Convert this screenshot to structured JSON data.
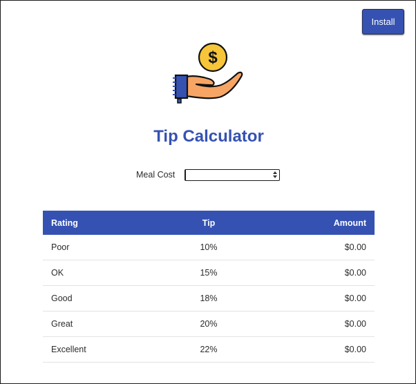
{
  "header": {
    "install_label": "Install"
  },
  "logo": {
    "icon": "hand-holding-dollar-coin-icon",
    "coin_symbol": "$"
  },
  "page": {
    "title": "Tip Calculator"
  },
  "form": {
    "meal_cost_label": "Meal Cost",
    "meal_cost_value": ""
  },
  "table": {
    "headers": {
      "rating": "Rating",
      "tip": "Tip",
      "amount": "Amount"
    },
    "rows": [
      {
        "rating": "Poor",
        "tip": "10%",
        "amount": "$0.00"
      },
      {
        "rating": "OK",
        "tip": "15%",
        "amount": "$0.00"
      },
      {
        "rating": "Good",
        "tip": "18%",
        "amount": "$0.00"
      },
      {
        "rating": "Great",
        "tip": "20%",
        "amount": "$0.00"
      },
      {
        "rating": "Excellent",
        "tip": "22%",
        "amount": "$0.00"
      }
    ]
  },
  "colors": {
    "accent": "#3552b2",
    "coin": "#f6c53a",
    "hand": "#f6a565",
    "sleeve": "#3552b2"
  }
}
